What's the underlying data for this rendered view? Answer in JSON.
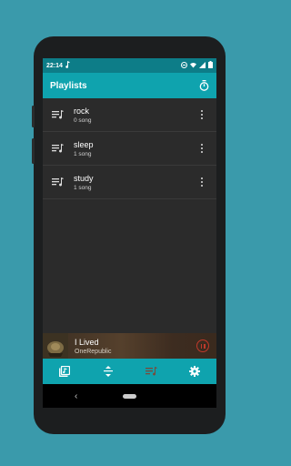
{
  "status_bar": {
    "time": "22:14",
    "icons": [
      "music-note-icon",
      "dnd-icon",
      "wifi-icon",
      "signal-icon",
      "battery-icon"
    ]
  },
  "app_bar": {
    "title": "Playlists",
    "action_icon": "timer-icon"
  },
  "playlists": [
    {
      "name": "rock",
      "count": "0 song"
    },
    {
      "name": "sleep",
      "count": "1 song"
    },
    {
      "name": "study",
      "count": "1 song"
    }
  ],
  "now_playing": {
    "song": "I Lived",
    "artist": "OneRepublic",
    "state_icon": "pause-icon",
    "accent": "#c0392b"
  },
  "bottom_nav": [
    "library-icon",
    "sort-icon",
    "playlist-icon",
    "settings-icon"
  ],
  "colors": {
    "primary": "#0fa3ae",
    "status_bar": "#0d7d88",
    "background": "#2b2b2b",
    "page": "#3a9aab"
  }
}
